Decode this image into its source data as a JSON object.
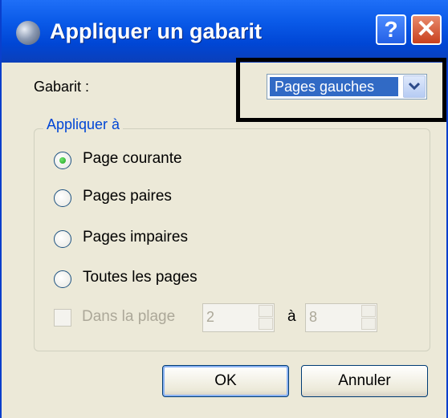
{
  "window": {
    "title": "Appliquer un gabarit",
    "help_label": "?",
    "close_label": "✕"
  },
  "gabarit": {
    "label": "Gabarit :",
    "selected": "Pages gauches"
  },
  "apply_group": {
    "legend": "Appliquer à",
    "options": [
      {
        "label": "Page courante",
        "checked": true
      },
      {
        "label": "Pages paires",
        "checked": false
      },
      {
        "label": "Pages impaires",
        "checked": false
      },
      {
        "label": "Toutes les pages",
        "checked": false
      }
    ],
    "range": {
      "label": "Dans la plage",
      "from": "2",
      "to_label": "à",
      "to": "8",
      "enabled": false
    }
  },
  "buttons": {
    "ok": "OK",
    "cancel": "Annuler"
  },
  "icons": {
    "title": "app-sphere-icon",
    "dropdown": "chevron-down-icon"
  },
  "colors": {
    "titlebar": "#0a5ae8",
    "accent": "#0046d5",
    "selection": "#316ac5",
    "highlight_box": "#000000"
  }
}
